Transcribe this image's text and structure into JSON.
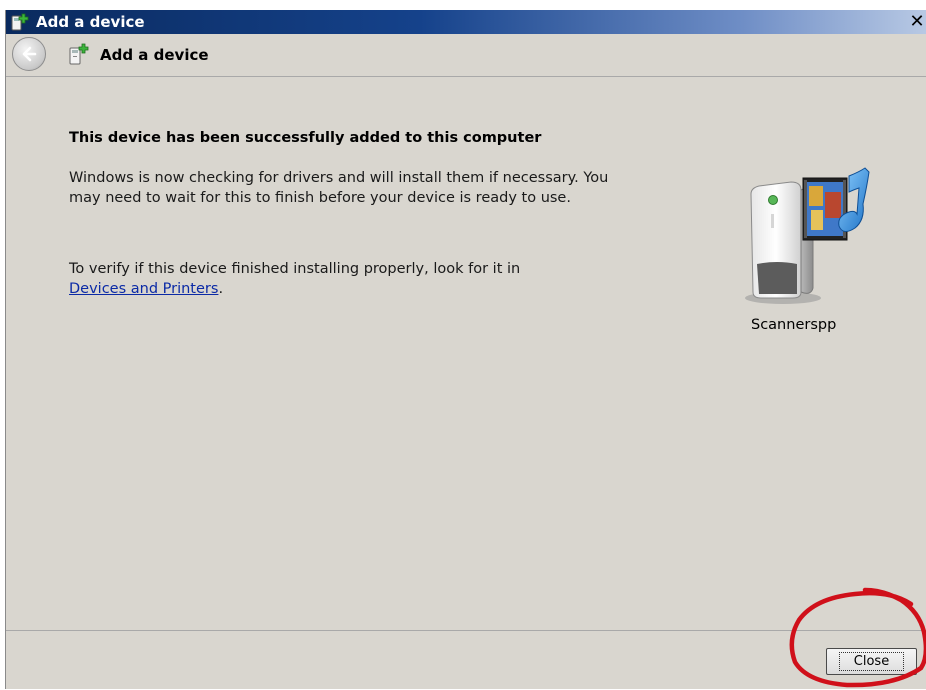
{
  "window": {
    "title": "Add a device",
    "close_glyph": "✕"
  },
  "nav": {
    "title": "Add a device",
    "back_icon": "back-arrow-icon",
    "device_icon": "add-device-icon"
  },
  "content": {
    "heading": "This device has been successfully added to this computer",
    "para1": "Windows is now checking for drivers and will install them if necessary. You may need to wait for this to finish before your device is ready to use.",
    "para2_prefix": "To verify if this device finished installing properly, look for it in",
    "link_text": "Devices and Printers",
    "para2_suffix": "."
  },
  "device": {
    "name": "Scannerspp",
    "icon": "media-device-icon"
  },
  "footer": {
    "close_label": "Close"
  },
  "colors": {
    "window_bg": "#d9d6cf",
    "titlebar": "#15428b",
    "link": "#0b2aa6",
    "annotation": "#d0101a"
  }
}
